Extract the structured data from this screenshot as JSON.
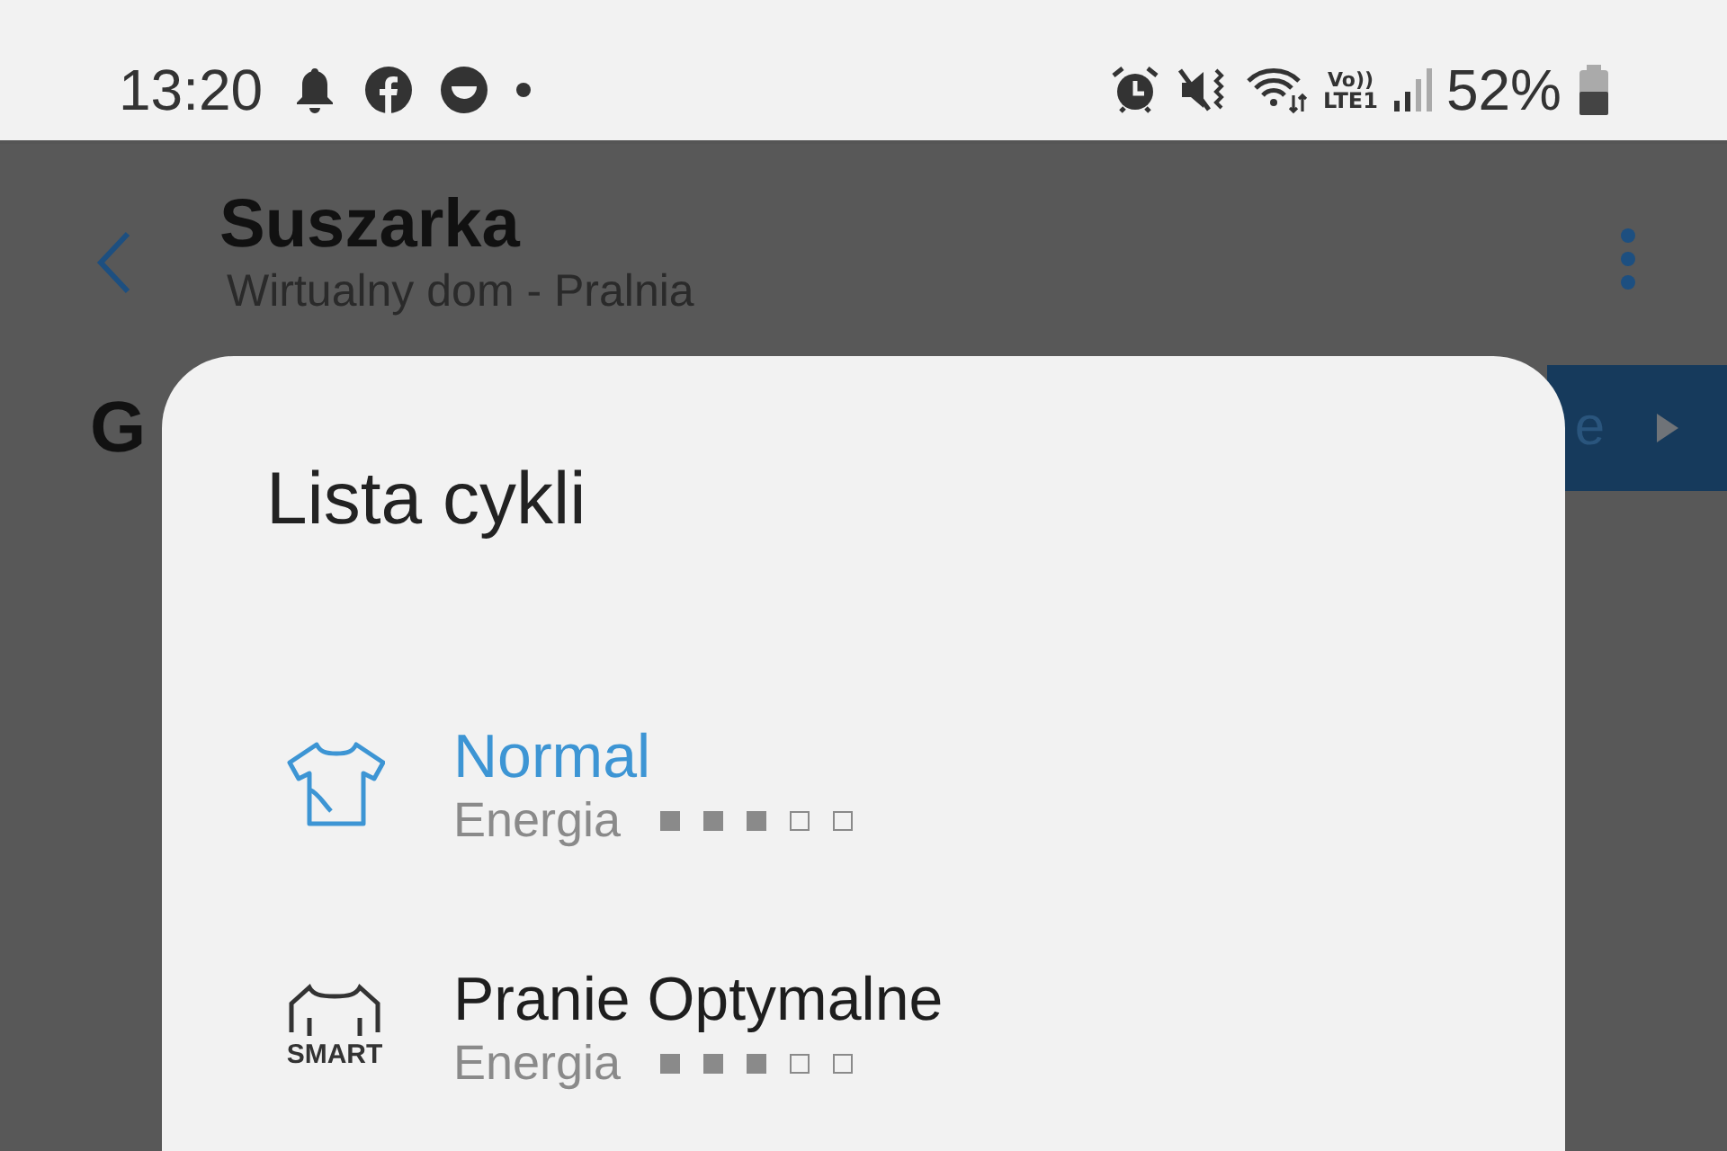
{
  "status_bar": {
    "time": "13:20",
    "battery": "52%",
    "network": "LTE1",
    "volte": "Vo))"
  },
  "app_bar": {
    "title": "Suszarka",
    "subtitle": "Wirtualny dom - Pralnia"
  },
  "background": {
    "heading": "G",
    "button_label": "e"
  },
  "dialog": {
    "title": "Lista cykli",
    "items": [
      {
        "name": "Normal",
        "selected": true,
        "kind": "shirt",
        "energy_label": "Energia",
        "stars": 3
      },
      {
        "name": "Pranie Optymalne",
        "selected": false,
        "kind": "smart",
        "icon_label": "SMART",
        "energy_label": "Energia",
        "stars": 3
      }
    ]
  }
}
